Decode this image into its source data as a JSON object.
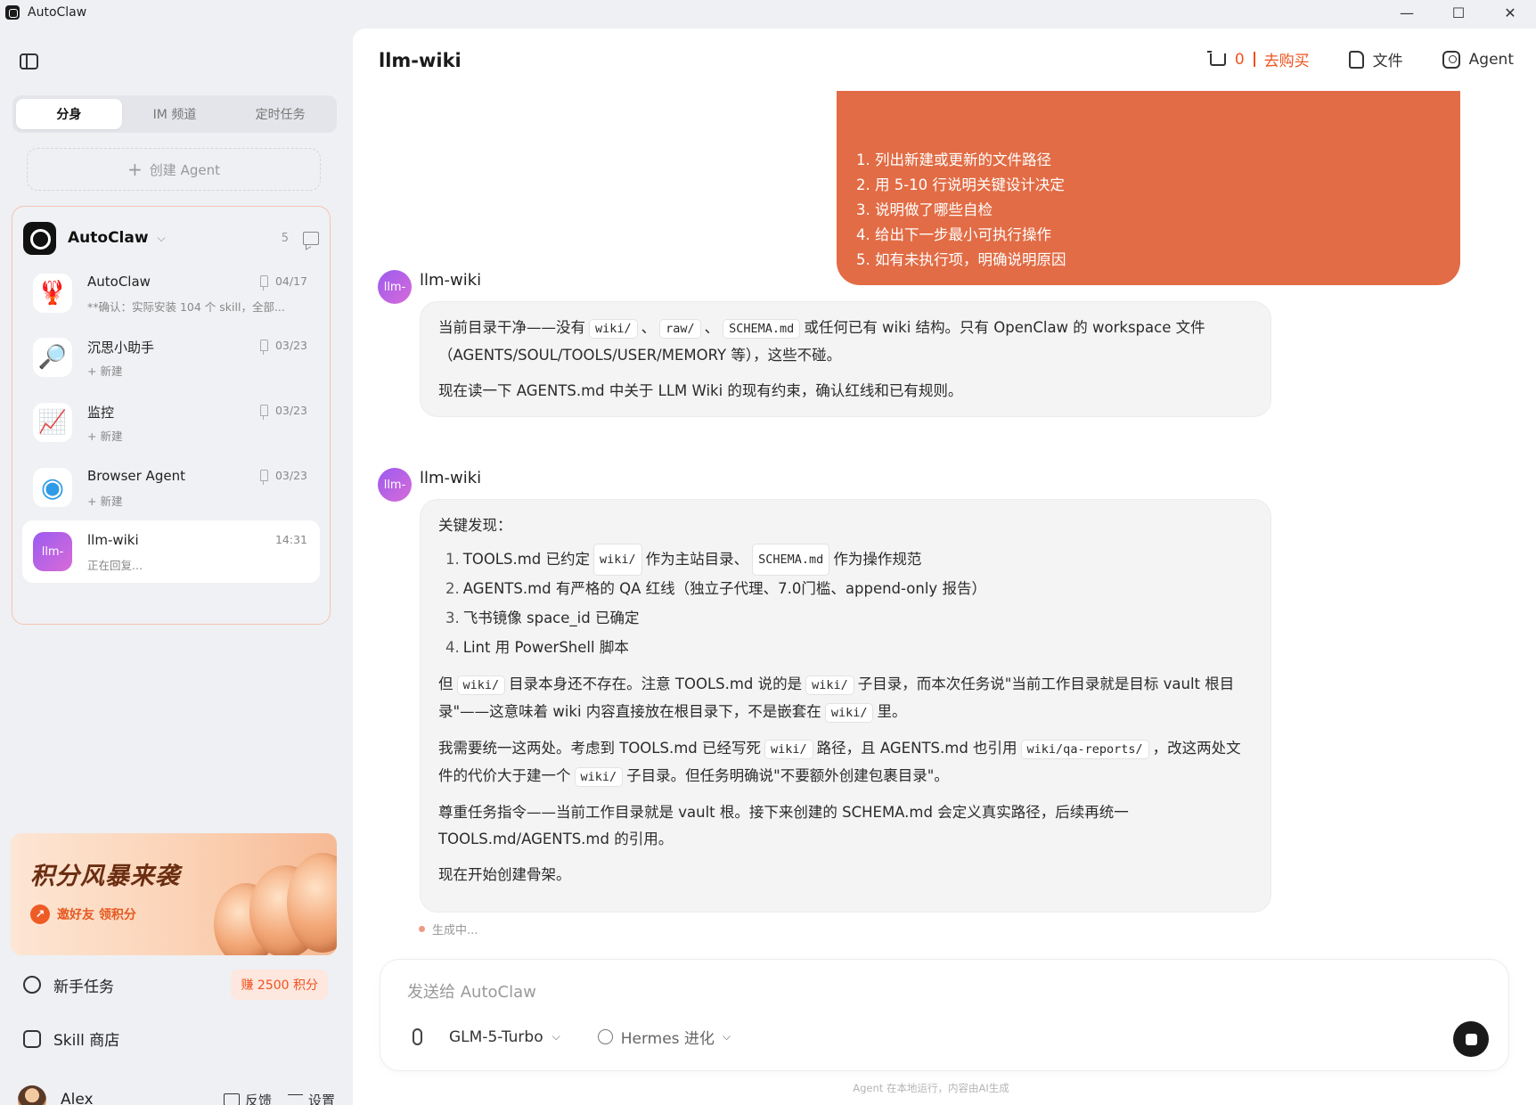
{
  "window": {
    "title": "AutoClaw",
    "controls": {
      "minimize": "—",
      "maximize": "☐",
      "close": "✕"
    }
  },
  "sidebar": {
    "tabs": [
      {
        "label": "分身",
        "active": true
      },
      {
        "label": "IM 频道",
        "active": false
      },
      {
        "label": "定时任务",
        "active": false
      }
    ],
    "create_agent": {
      "plus": "+",
      "label": "创建 Agent"
    },
    "group": {
      "name": "AutoClaw",
      "chevron": "⌵",
      "count": "5",
      "agents": [
        {
          "title": "AutoClaw",
          "subtitle": "**确认：实际安装 104 个 skill，全部...",
          "date": "04/17",
          "pinned": true,
          "avatar": "🦞"
        },
        {
          "title": "沉思小助手",
          "subtitle": "+ 新建",
          "date": "03/23",
          "pinned": true,
          "avatar": "🔎"
        },
        {
          "title": "监控",
          "subtitle": "+ 新建",
          "date": "03/23",
          "pinned": true,
          "avatar": "📈"
        },
        {
          "title": "Browser Agent",
          "subtitle": "+ 新建",
          "date": "03/23",
          "pinned": true,
          "avatar": "◉"
        },
        {
          "title": "llm-wiki",
          "subtitle": "正在回复...",
          "date": "14:31",
          "pinned": false,
          "avatar": "llm-"
        }
      ]
    },
    "promo": {
      "title": "积分风暴来袭",
      "arrow": "↗",
      "subtitle": "邀好友 领积分"
    },
    "beginner_task": {
      "label": "新手任务",
      "reward": "赚 2500 积分"
    },
    "skill_store": {
      "label": "Skill 商店"
    },
    "user": {
      "name": "Alex",
      "feedback": "反馈",
      "settings": "设置"
    }
  },
  "main": {
    "title": "llm-wiki",
    "header": {
      "cart_count": "0",
      "cart_buy": "去购买",
      "files": "文件",
      "agent": "Agent"
    },
    "user_message": {
      "lines": [
        "1. 列出新建或更新的文件路径",
        "2. 用 5-10 行说明关键设计决定",
        "3. 说明做了哪些自检",
        "4. 给出下一步最小可执行操作",
        "5. 如有未执行项，明确说明原因"
      ]
    },
    "bot_messages": [
      {
        "avatar": "llm-",
        "name": "llm-wiki",
        "p1": {
          "t1": "当前目录干净——没有",
          "c1": "wiki/",
          "t2": "、",
          "c2": "raw/",
          "t3": "、",
          "c3": "SCHEMA.md",
          "t4": "或任何已有 wiki 结构。只有 OpenClaw 的 workspace 文件（AGENTS/SOUL/TOOLS/USER/MEMORY 等），这些不碰。"
        },
        "p2": "现在读一下 AGENTS.md 中关于 LLM Wiki 的现有约束，确认红线和已有规则。"
      },
      {
        "avatar": "llm-",
        "name": "llm-wiki",
        "intro": "关键发现：",
        "findings": [
          {
            "num": "1.",
            "t1": "TOOLS.md 已约定",
            "c1": "wiki/",
            "t2": "作为主站目录、",
            "c2": "SCHEMA.md",
            "t3": "作为操作规范"
          },
          {
            "num": "2.",
            "t1": "AGENTS.md 有严格的 QA 红线（独立子代理、7.0门槛、append-only 报告）"
          },
          {
            "num": "3.",
            "t1": "飞书镜像 space_id 已确定"
          },
          {
            "num": "4.",
            "t1": "Lint 用 PowerShell 脚本"
          }
        ],
        "p_but": {
          "t1": "但",
          "c1": "wiki/",
          "t2": "目录本身还不存在。注意 TOOLS.md 说的是",
          "c2": "wiki/",
          "t3": "子目录，而本次任务说\"当前工作目录就是目标 vault 根目录\"——这意味着 wiki 内容直接放在根目录下，不是嵌套在",
          "c3": "wiki/",
          "t4": "里。"
        },
        "p_unify": {
          "t1": "我需要统一这两处。考虑到 TOOLS.md 已经写死",
          "c1": "wiki/",
          "t2": "路径，且 AGENTS.md 也引用",
          "c2": "wiki/qa-reports/",
          "t3": "，改这两处文件的代价大于建一个",
          "c3": "wiki/",
          "t4": "子目录。但任务明确说\"不要额外创建包裹目录\"。"
        },
        "p_respect": "尊重任务指令——当前工作目录就是 vault 根。接下来创建的 SCHEMA.md 会定义真实路径，后续再统一 TOOLS.md/AGENTS.md 的引用。",
        "p_start": "现在开始创建骨架。"
      }
    ],
    "status": "生成中...",
    "composer": {
      "placeholder": "发送给 AutoClaw",
      "model": "GLM-5-Turbo",
      "mode": "Hermes 进化",
      "chevron": "⌵"
    },
    "disclaimer": "Agent 在本地运行，内容由AI生成"
  }
}
